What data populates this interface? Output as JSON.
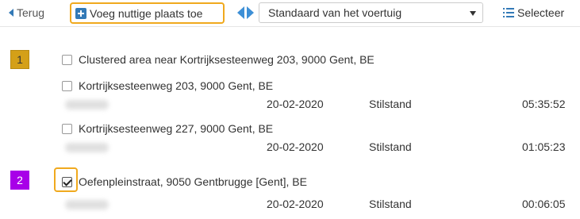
{
  "toolbar": {
    "back_label": "Terug",
    "add_place_label": "Voeg nuttige plaats toe",
    "vehicle_select_value": "Standaard van het voertuig",
    "select_label": "Selecteer"
  },
  "groups": [
    {
      "number": "1",
      "badge_color": "#d4a018",
      "cluster_label": "Clustered area near Kortrijksesteenweg 203, 9000 Gent, BE",
      "items": [
        {
          "address": "Kortrijksesteenweg 203, 9000 Gent, BE",
          "date": "20-02-2020",
          "status": "Stilstand",
          "duration": "05:35:52",
          "checked": false
        },
        {
          "address": "Kortrijksesteenweg 227, 9000 Gent, BE",
          "date": "20-02-2020",
          "status": "Stilstand",
          "duration": "01:05:23",
          "checked": false
        }
      ]
    },
    {
      "number": "2",
      "badge_color": "#a800e8",
      "items": [
        {
          "address": "Oefenpleinstraat, 9050 Gentbrugge [Gent], BE",
          "date": "20-02-2020",
          "status": "Stilstand",
          "duration": "00:06:05",
          "checked": true
        }
      ]
    }
  ],
  "colors": {
    "accent_blue": "#337ab7",
    "highlight_orange": "#f0a91e"
  },
  "icons": {
    "back": "caret-left-icon",
    "add": "plus-square-icon",
    "swap": "left-right-arrows-icon",
    "dropdown": "caret-down-icon",
    "select": "list-icon"
  }
}
